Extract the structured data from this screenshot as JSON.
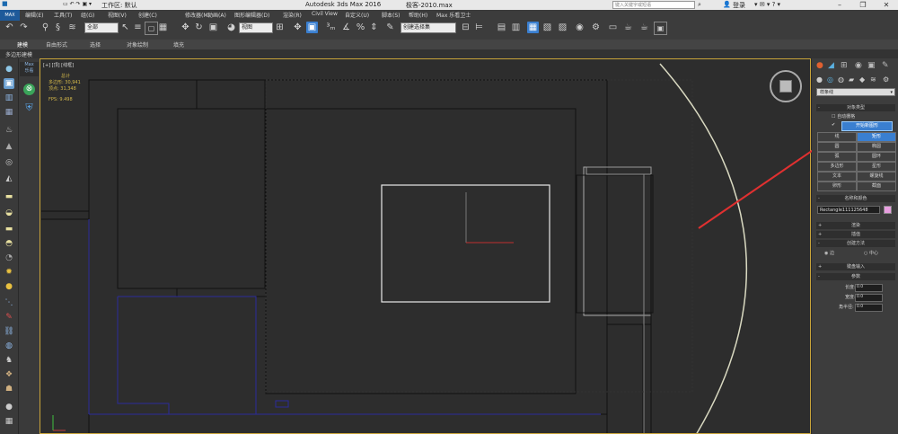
{
  "titlebar": {
    "workspace_label": "工作区: 默认",
    "app_title": "Autodesk 3ds Max 2016",
    "file_name": "极客-2010.max",
    "search_placeholder": "键入关键字或短语",
    "login_label": "登录"
  },
  "menubar": {
    "items": [
      "编辑(E)",
      "工具(T)",
      "组(G)",
      "视图(V)",
      "创建(C)",
      "修改器(M)",
      "动画(A)",
      "图形编辑器(D)",
      "渲染(R)",
      "Civil View",
      "自定义(U)",
      "脚本(S)",
      "帮助(H)",
      "Max 乐看卫士"
    ]
  },
  "toolbar": {
    "selection_filter": "全部",
    "reference_coord": "视图",
    "named_selection": "创建选择集"
  },
  "ribbon": {
    "tabs": [
      "建模",
      "自由形式",
      "选择",
      "对象绘制",
      "填充"
    ],
    "sub_label": "多边形建模"
  },
  "viewport": {
    "label": "[+] [顶] [线框]",
    "stats": {
      "title": "总计",
      "polys_label": "多边形:",
      "polys_value": "30,941",
      "verts_label": "顶点:",
      "verts_value": "31,348",
      "fps_label": "FPS:",
      "fps_value": "9.498"
    }
  },
  "leftpanel": {
    "max_label": "Max",
    "max_sub": "乐看"
  },
  "cmdpanel": {
    "category": "样条线",
    "object_type_header": "对象类型",
    "autogrid_label": "自动栅格",
    "start_new_shape": "开始新图形",
    "buttons": [
      "线",
      "矩形",
      "圆",
      "椭圆",
      "弧",
      "圆环",
      "多边形",
      "星形",
      "文本",
      "螺旋线",
      "卵形",
      "截面"
    ],
    "name_color_header": "名称和颜色",
    "object_name": "Rectangle111125648",
    "render_header": "渲染",
    "interp_header": "插值",
    "creation_method_header": "创建方法",
    "method_edge": "边",
    "method_center": "中心",
    "keyboard_header": "键盘输入",
    "params_header": "参数",
    "length_label": "长度:",
    "length_value": "0.0",
    "width_label": "宽度:",
    "width_value": "0.0",
    "corner_label": "角半径:",
    "corner_value": "0.0",
    "swatch_color": "#e89ee0"
  },
  "colors": {
    "arrow": "#e03030",
    "active_button": "#3a7fd0",
    "selection_rect": "#e8e8e8",
    "blue_lines": "#2a2a9a",
    "viewport_border": "#c9a43a"
  }
}
